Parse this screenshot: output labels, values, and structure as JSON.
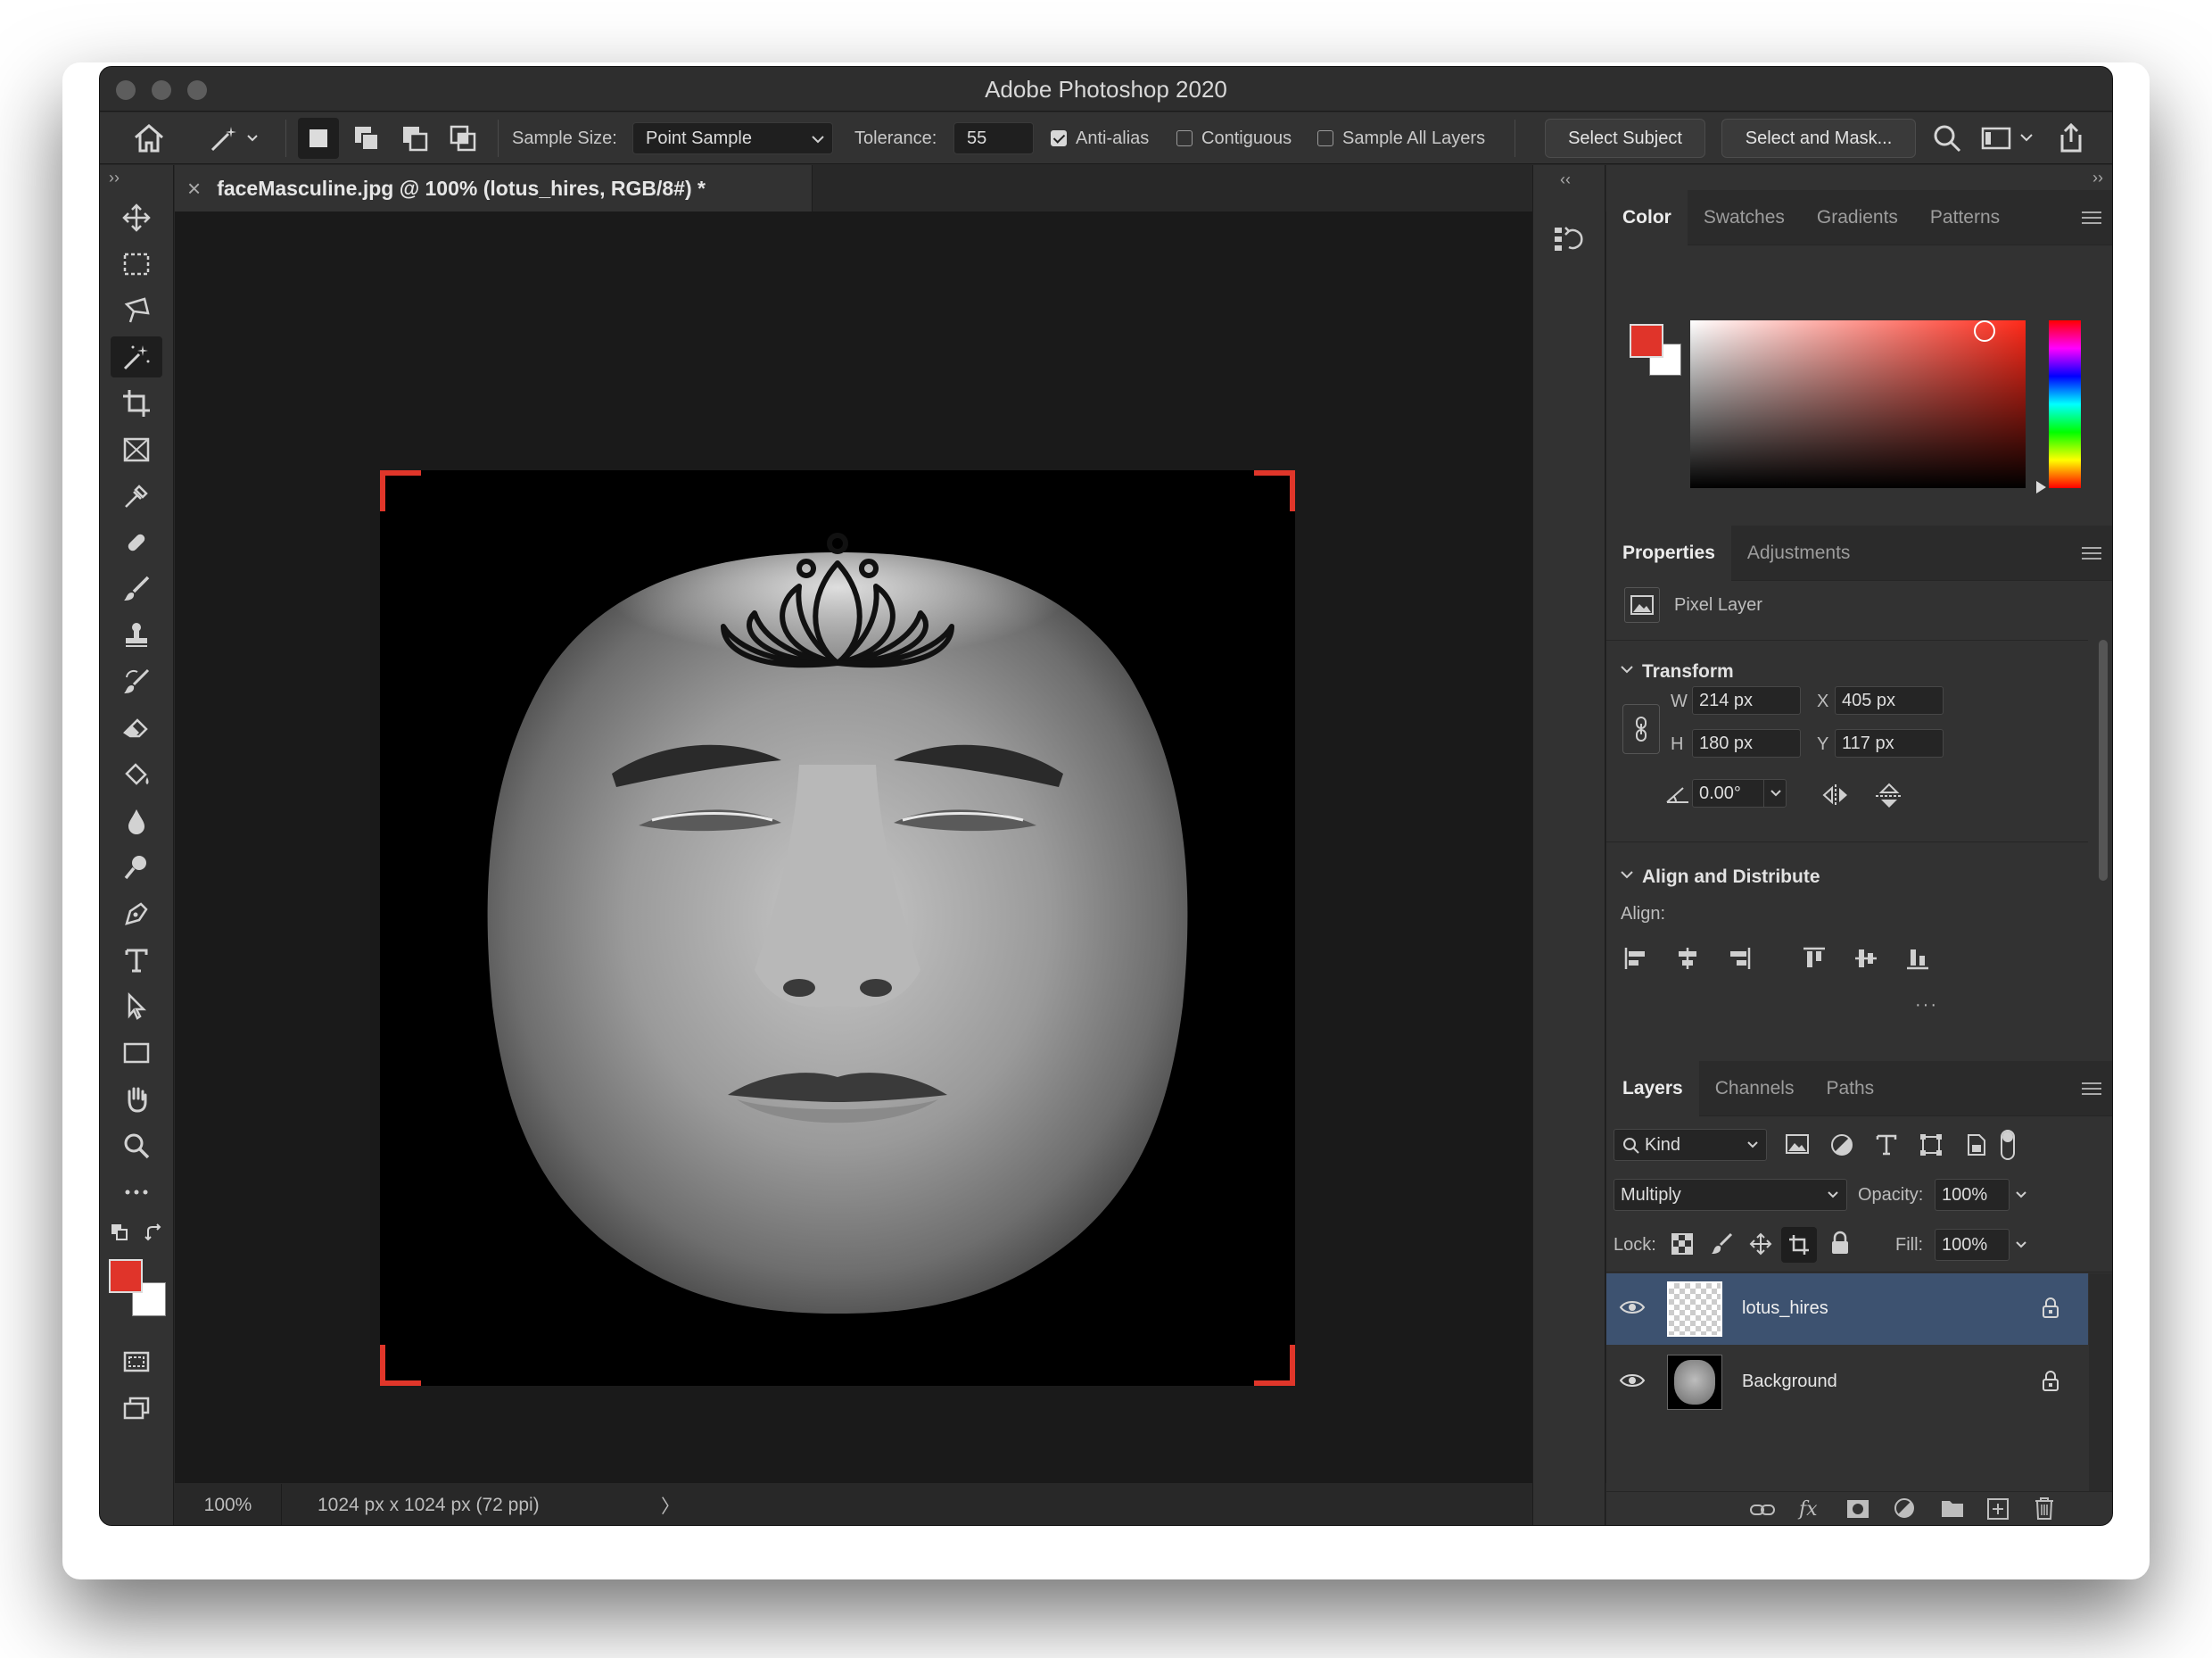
{
  "window": {
    "title": "Adobe Photoshop 2020"
  },
  "options": {
    "sample_size_label": "Sample Size:",
    "sample_size_value": "Point Sample",
    "tolerance_label": "Tolerance:",
    "tolerance_value": "55",
    "anti_alias": "Anti-alias",
    "contiguous": "Contiguous",
    "sample_all_layers": "Sample All Layers",
    "select_subject": "Select Subject",
    "select_and_mask": "Select and Mask..."
  },
  "document": {
    "tab_title": "faceMasculine.jpg @ 100% (lotus_hires, RGB/8#) *",
    "close_glyph": "×"
  },
  "status": {
    "zoom": "100%",
    "info": "1024 px x 1024 px (72 ppi)",
    "arrow": "〉"
  },
  "collapse": {
    "left": "››",
    "right": "‹‹",
    "right2": "››"
  },
  "color_panel": {
    "tabs": [
      "Color",
      "Swatches",
      "Gradients",
      "Patterns"
    ],
    "foreground": "#e0342a",
    "background": "#ffffff"
  },
  "properties": {
    "tabs": [
      "Properties",
      "Adjustments"
    ],
    "kind": "Pixel Layer",
    "transform_title": "Transform",
    "w_label": "W",
    "w": "214 px",
    "x_label": "X",
    "x": "405 px",
    "h_label": "H",
    "h": "180 px",
    "y_label": "Y",
    "y": "117 px",
    "angle": "0.00°",
    "align_title": "Align and Distribute",
    "align_label": "Align:",
    "more": "···"
  },
  "layers": {
    "tabs": [
      "Layers",
      "Channels",
      "Paths"
    ],
    "filter": "Kind",
    "blend_mode": "Multiply",
    "opacity_label": "Opacity:",
    "opacity": "100%",
    "lock_label": "Lock:",
    "fill_label": "Fill:",
    "fill": "100%",
    "items": [
      {
        "name": "lotus_hires",
        "selected": true
      },
      {
        "name": "Background",
        "selected": false
      }
    ]
  }
}
